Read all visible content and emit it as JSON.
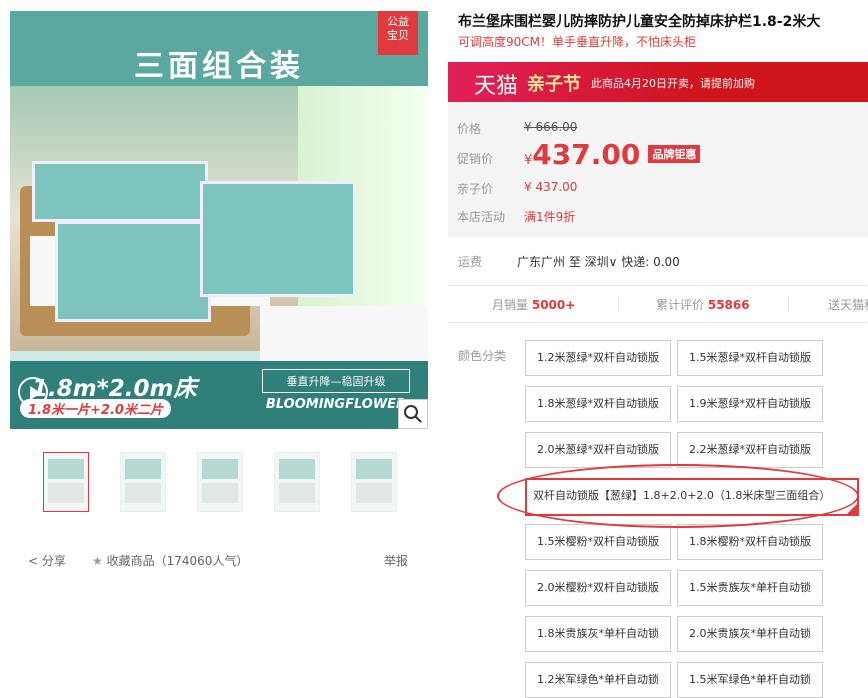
{
  "gallery": {
    "badge": "公益\n宝贝",
    "main_title": "三面组合装",
    "size_text": "1.8m*2.0m床",
    "size_sub": "1.8米一片+2.0米二片",
    "slogan": "垂直升降—稳固升级",
    "slogan_en": "BLOOMINGFLOWER",
    "play_icon": "play-icon",
    "zoom_icon": "magnifier-icon",
    "thumbnails": 5
  },
  "actions": {
    "share": "分享",
    "collect": "收藏商品",
    "popularity": "（174060人气）",
    "report": "举报"
  },
  "product": {
    "title": "布兰堡床围栏婴儿防摔防护儿童安全防掉床护栏1.8-2米大",
    "subtitle": "可调高度90CM！单手垂直升降，不怕床头柜"
  },
  "banner": {
    "brand": "天猫",
    "festival": "亲子节",
    "note": "此商品4月20日开卖，请提前加购"
  },
  "price": {
    "price_label": "价格",
    "price_value": "¥ 666.00",
    "promo_label": "促销价",
    "promo_currency": "¥",
    "promo_value": "437.00",
    "promo_tag": "品牌钜惠",
    "parent_label": "亲子价",
    "parent_value": "¥ 437.00",
    "store_label": "本店活动",
    "store_value": "满1件9折"
  },
  "shipping": {
    "label": "运费",
    "value": "广东广州 至 深圳∨ 快递: 0.00"
  },
  "stats": {
    "monthly_label": "月销量",
    "monthly_value": "5000+",
    "reviews_label": "累计评价",
    "reviews_value": "55866",
    "gift_label": "送天猫积"
  },
  "sku": {
    "label": "颜色分类",
    "items": [
      "1.2米葱绿*双杆自动锁版",
      "1.5米葱绿*双杆自动锁版",
      "1.8米葱绿*双杆自动锁版",
      "1.9米葱绿*双杆自动锁版",
      "2.0米葱绿*双杆自动锁版",
      "2.2米葱绿*双杆自动锁版",
      "双杆自动锁版【葱绿】1.8+2.0+2.0（1.8米床型三面组合）",
      "1.5米樱粉*双杆自动锁版",
      "1.8米樱粉*双杆自动锁版",
      "2.0米樱粉*双杆自动锁版",
      "1.5米贵族灰*单杆自动锁",
      "1.8米贵族灰*单杆自动锁",
      "2.0米贵族灰*单杆自动锁",
      "1.2米军绿色*单杆自动锁",
      "1.5米军绿色*单杆自动锁"
    ],
    "selected_index": 6
  },
  "colors": {
    "accent": "#e03a3e",
    "teal": "#2f7f7a"
  }
}
